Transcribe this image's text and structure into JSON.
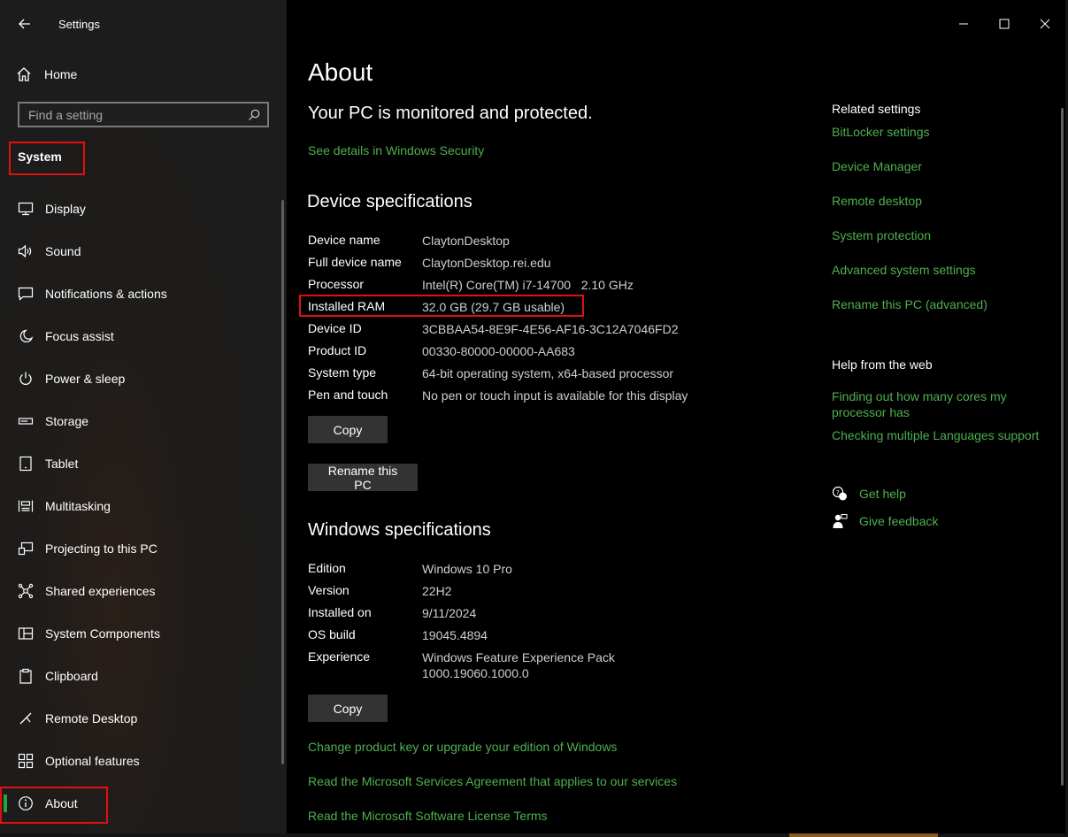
{
  "window": {
    "title": "Settings"
  },
  "sidebar": {
    "home_label": "Home",
    "search_placeholder": "Find a setting",
    "section_title": "System",
    "items": [
      {
        "label": "Display",
        "icon": "display-icon"
      },
      {
        "label": "Sound",
        "icon": "sound-icon"
      },
      {
        "label": "Notifications & actions",
        "icon": "notifications-icon"
      },
      {
        "label": "Focus assist",
        "icon": "moon-icon"
      },
      {
        "label": "Power & sleep",
        "icon": "power-icon"
      },
      {
        "label": "Storage",
        "icon": "storage-icon"
      },
      {
        "label": "Tablet",
        "icon": "tablet-icon"
      },
      {
        "label": "Multitasking",
        "icon": "multitasking-icon"
      },
      {
        "label": "Projecting to this PC",
        "icon": "projecting-icon"
      },
      {
        "label": "Shared experiences",
        "icon": "shared-icon"
      },
      {
        "label": "System Components",
        "icon": "components-icon"
      },
      {
        "label": "Clipboard",
        "icon": "clipboard-icon"
      },
      {
        "label": "Remote Desktop",
        "icon": "remote-desktop-icon"
      },
      {
        "label": "Optional features",
        "icon": "optional-features-icon"
      },
      {
        "label": "About",
        "icon": "info-icon",
        "active": true
      }
    ]
  },
  "main": {
    "title": "About",
    "protection_status": "Your PC is monitored and protected.",
    "security_link": "See details in Windows Security",
    "device_specs": {
      "heading": "Device specifications",
      "rows": [
        {
          "key": "Device name",
          "value": "ClaytonDesktop"
        },
        {
          "key": "Full device name",
          "value": "ClaytonDesktop.rei.edu"
        },
        {
          "key": "Processor",
          "value": "Intel(R) Core(TM) i7-14700   2.10 GHz"
        },
        {
          "key": "Installed RAM",
          "value": "32.0 GB (29.7 GB usable)"
        },
        {
          "key": "Device ID",
          "value": "3CBBAA54-8E9F-4E56-AF16-3C12A7046FD2"
        },
        {
          "key": "Product ID",
          "value": "00330-80000-00000-AA683"
        },
        {
          "key": "System type",
          "value": "64-bit operating system, x64-based processor"
        },
        {
          "key": "Pen and touch",
          "value": "No pen or touch input is available for this display"
        }
      ],
      "copy_label": "Copy",
      "rename_label": "Rename this PC"
    },
    "windows_specs": {
      "heading": "Windows specifications",
      "rows": [
        {
          "key": "Edition",
          "value": "Windows 10 Pro"
        },
        {
          "key": "Version",
          "value": "22H2"
        },
        {
          "key": "Installed on",
          "value": "9/11/2024"
        },
        {
          "key": "OS build",
          "value": "19045.4894"
        },
        {
          "key": "Experience",
          "value": "Windows Feature Experience Pack",
          "value2": "1000.19060.1000.0"
        }
      ],
      "copy_label": "Copy"
    },
    "bottom_links": [
      "Change product key or upgrade your edition of Windows",
      "Read the Microsoft Services Agreement that applies to our services",
      "Read the Microsoft Software License Terms"
    ]
  },
  "related": {
    "heading": "Related settings",
    "links": [
      "BitLocker settings",
      "Device Manager",
      "Remote desktop",
      "System protection",
      "Advanced system settings",
      "Rename this PC (advanced)"
    ],
    "help_heading": "Help from the web",
    "help_links": [
      "Finding out how many cores my processor has",
      "Checking multiple Languages support"
    ],
    "get_help": "Get help",
    "give_feedback": "Give feedback"
  },
  "colors": {
    "link": "#4fb04f",
    "accent": "#2aa336",
    "highlight": "#e01010"
  }
}
